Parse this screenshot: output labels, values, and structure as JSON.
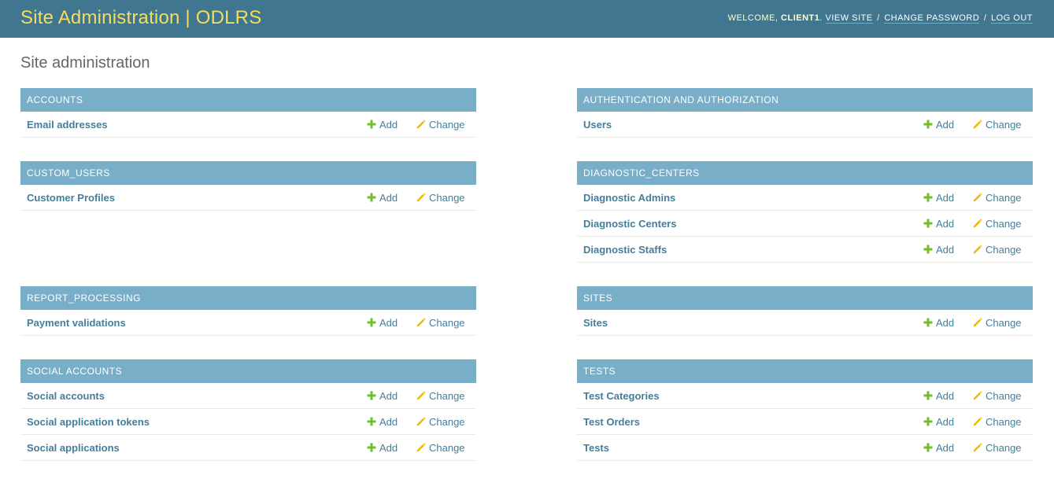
{
  "header": {
    "site_title": "Site Administration | ODLRS",
    "welcome_prefix": "WELCOME,",
    "username": "CLIENT1",
    "welcome_suffix": ".",
    "view_site": "VIEW SITE",
    "change_password": "CHANGE PASSWORD",
    "log_out": "LOG OUT",
    "separator": "/"
  },
  "page": {
    "title": "Site administration"
  },
  "actions": {
    "add": "Add",
    "change": "Change"
  },
  "colors": {
    "header_bg": "#417690",
    "branding": "#f5dd5d",
    "caption_bg": "#79aec8",
    "link": "#447e9b",
    "add_icon": "#70bf2b",
    "change_icon": "#efb80b"
  },
  "modules": [
    {
      "caption": "ACCOUNTS",
      "models": [
        {
          "name": "Email addresses"
        }
      ]
    },
    {
      "caption": "AUTHENTICATION AND AUTHORIZATION",
      "models": [
        {
          "name": "Users"
        }
      ]
    },
    {
      "caption": "CUSTOM_USERS",
      "models": [
        {
          "name": "Customer Profiles"
        }
      ]
    },
    {
      "caption": "DIAGNOSTIC_CENTERS",
      "models": [
        {
          "name": "Diagnostic Admins"
        },
        {
          "name": "Diagnostic Centers"
        },
        {
          "name": "Diagnostic Staffs"
        }
      ]
    },
    {
      "caption": "REPORT_PROCESSING",
      "models": [
        {
          "name": "Payment validations"
        }
      ]
    },
    {
      "caption": "SITES",
      "models": [
        {
          "name": "Sites"
        }
      ]
    },
    {
      "caption": "SOCIAL ACCOUNTS",
      "models": [
        {
          "name": "Social accounts"
        },
        {
          "name": "Social application tokens"
        },
        {
          "name": "Social applications"
        }
      ]
    },
    {
      "caption": "TESTS",
      "models": [
        {
          "name": "Test Categories"
        },
        {
          "name": "Test Orders"
        },
        {
          "name": "Tests"
        }
      ]
    }
  ]
}
